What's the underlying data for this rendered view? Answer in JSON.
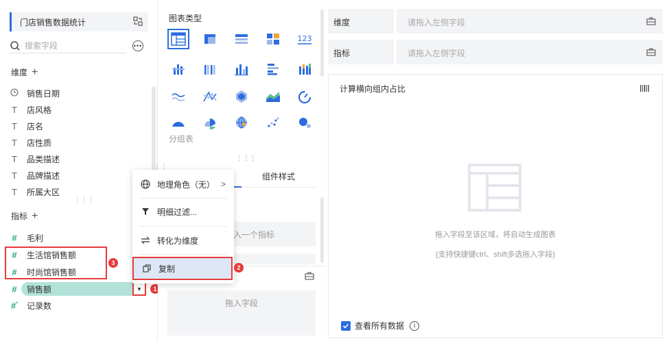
{
  "left": {
    "dataset_name": "门店销售数据统计",
    "search_placeholder": "搜索字段",
    "dimension_title": "维度",
    "measure_title": "指标",
    "add_symbol": "+",
    "dimensions": [
      {
        "icon": "clock-icon",
        "label": "销售日期"
      },
      {
        "icon": "text-type-icon",
        "label": "店风格"
      },
      {
        "icon": "text-type-icon",
        "label": "店名"
      },
      {
        "icon": "text-type-icon",
        "label": "店性质"
      },
      {
        "icon": "text-type-icon",
        "label": "品类描述"
      },
      {
        "icon": "text-type-icon",
        "label": "品牌描述"
      },
      {
        "icon": "text-type-icon",
        "label": "所属大区"
      }
    ],
    "measures": [
      {
        "icon": "number-type-icon",
        "label": "毛利"
      },
      {
        "icon": "number-type-icon",
        "label": "生活馆销售额"
      },
      {
        "icon": "number-type-icon",
        "label": "时尚馆销售额"
      },
      {
        "icon": "number-type-icon",
        "label": "销售额"
      },
      {
        "icon": "count-type-icon",
        "label": "记录数"
      }
    ]
  },
  "badges": {
    "b1": "1",
    "b2": "2",
    "b3": "3"
  },
  "middle": {
    "chart_type_title": "图表类型",
    "group_table_label": "分组表",
    "tab_component_style": "组件样式",
    "ghost_text": "入一个指标",
    "drop_field_text": "拖入字段"
  },
  "context_menu": {
    "items": [
      {
        "icon": "globe-icon",
        "label": "地理角色（无）",
        "has_submenu": true
      },
      {
        "icon": "filter-icon",
        "label": "明细过滤..."
      },
      {
        "icon": "swap-icon",
        "label": "转化为维度"
      },
      {
        "icon": "copy-icon",
        "label": "复制",
        "highlighted": true
      }
    ]
  },
  "right": {
    "dimension_shelf_label": "维度",
    "measure_shelf_label": "指标",
    "shelf_placeholder": "请拖入左侧字段",
    "component_title": "计算横向组内占比",
    "hint_line1": "拖入字段至该区域，将自动生成图表",
    "hint_line2": "(支持快捷键ctrl、shift多选拖入字段)",
    "view_all_label": "查看所有数据",
    "view_all_checked": true
  },
  "colors": {
    "accent": "#2d6cdf",
    "annotation_red": "#e63a3a",
    "measure_green": "#2aa68a",
    "chip_bg": "#b2e3d8"
  }
}
